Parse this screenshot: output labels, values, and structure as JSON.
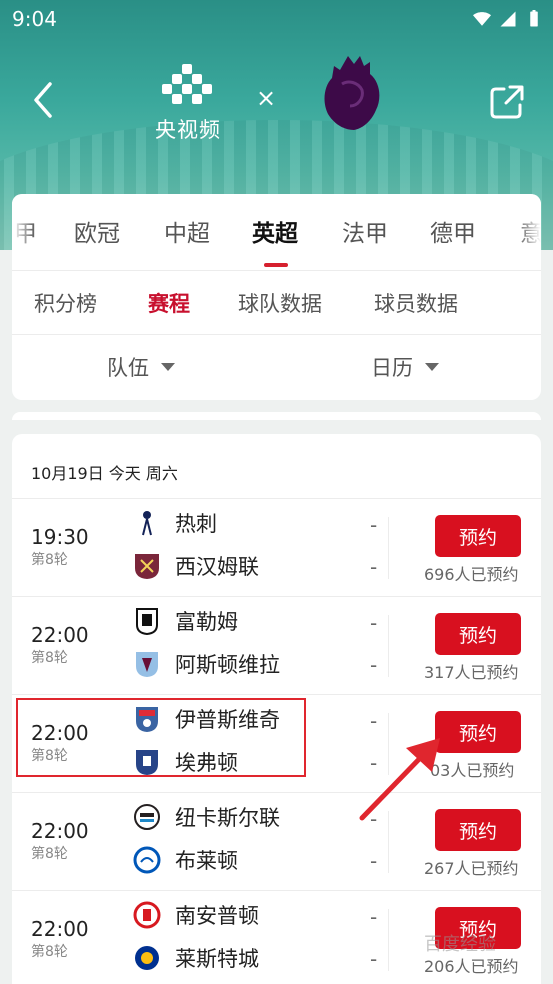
{
  "status_bar": {
    "time": "9:04"
  },
  "header": {
    "broadcaster": "央视频",
    "separator": "×"
  },
  "league_tabs": [
    {
      "label": "甲",
      "active": false
    },
    {
      "label": "欧冠",
      "active": false
    },
    {
      "label": "中超",
      "active": false
    },
    {
      "label": "英超",
      "active": true
    },
    {
      "label": "法甲",
      "active": false
    },
    {
      "label": "德甲",
      "active": false
    },
    {
      "label": "意",
      "active": false
    }
  ],
  "sub_tabs": [
    {
      "label": "积分榜",
      "active": false
    },
    {
      "label": "赛程",
      "active": true
    },
    {
      "label": "球队数据",
      "active": false
    },
    {
      "label": "球员数据",
      "active": false
    }
  ],
  "filters": {
    "team": "队伍",
    "calendar": "日历"
  },
  "schedule": {
    "date_header": "10月19日 今天 周六",
    "matches": [
      {
        "time": "19:30",
        "round": "第8轮",
        "home": "热刺",
        "away": "西汉姆联",
        "home_score": "-",
        "away_score": "-",
        "button": "预约",
        "count": "696人已预约"
      },
      {
        "time": "22:00",
        "round": "第8轮",
        "home": "富勒姆",
        "away": "阿斯顿维拉",
        "home_score": "-",
        "away_score": "-",
        "button": "预约",
        "count": "317人已预约"
      },
      {
        "time": "22:00",
        "round": "第8轮",
        "home": "伊普斯维奇",
        "away": "埃弗顿",
        "home_score": "-",
        "away_score": "-",
        "button": "预约",
        "count": "03人已预约"
      },
      {
        "time": "22:00",
        "round": "第8轮",
        "home": "纽卡斯尔联",
        "away": "布莱顿",
        "home_score": "-",
        "away_score": "-",
        "button": "预约",
        "count": "267人已预约"
      },
      {
        "time": "22:00",
        "round": "第8轮",
        "home": "南安普顿",
        "away": "莱斯特城",
        "home_score": "-",
        "away_score": "-",
        "button": "预约",
        "count": "206人已预约"
      }
    ]
  },
  "watermark": "百度经验",
  "colors": {
    "accent": "#d8101f",
    "header_teal": "#3aa89c",
    "highlight": "#e0262e"
  },
  "icons": {
    "back": "chevron-left-icon",
    "share": "share-icon",
    "wifi": "wifi-icon",
    "signal": "signal-icon",
    "battery": "battery-icon",
    "caret": "caret-down-icon"
  }
}
